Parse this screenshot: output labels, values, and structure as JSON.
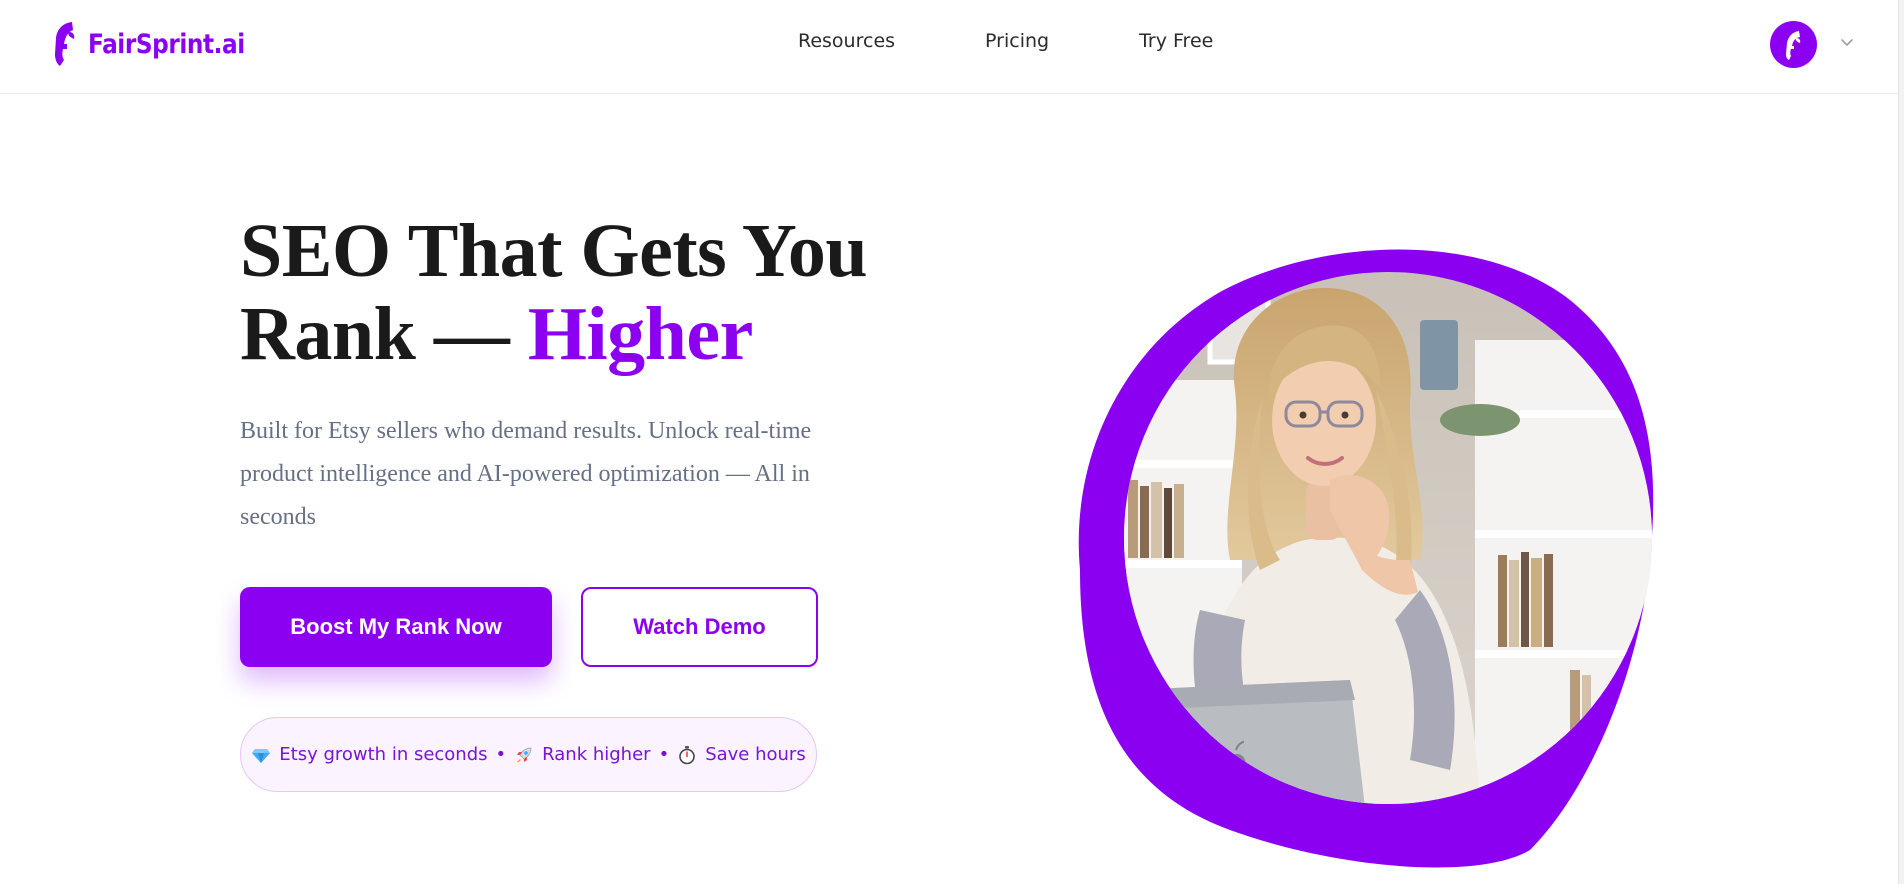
{
  "header": {
    "brand": "FairSprint.ai",
    "nav": [
      {
        "label": "Resources"
      },
      {
        "label": "Pricing"
      },
      {
        "label": "Try Free"
      }
    ]
  },
  "hero": {
    "headline_line1": "SEO That Gets You",
    "headline_line2_prefix": "Rank —",
    "headline_accent": "Higher",
    "subtext": "Built for Etsy sellers who demand results. Unlock real-time product intelligence and AI-powered optimization — All in seconds",
    "primary_cta": "Boost My Rank Now",
    "secondary_cta": "Watch Demo",
    "highlights": [
      {
        "icon": "gem-icon",
        "label": "Etsy growth in seconds"
      },
      {
        "icon": "rocket-icon",
        "label": "Rank higher"
      },
      {
        "icon": "stopwatch-icon",
        "label": "Save hours"
      }
    ],
    "separator": "•"
  },
  "colors": {
    "brand": "#8b00f0",
    "headline": "#1a1a1a",
    "subtext": "#667085"
  }
}
